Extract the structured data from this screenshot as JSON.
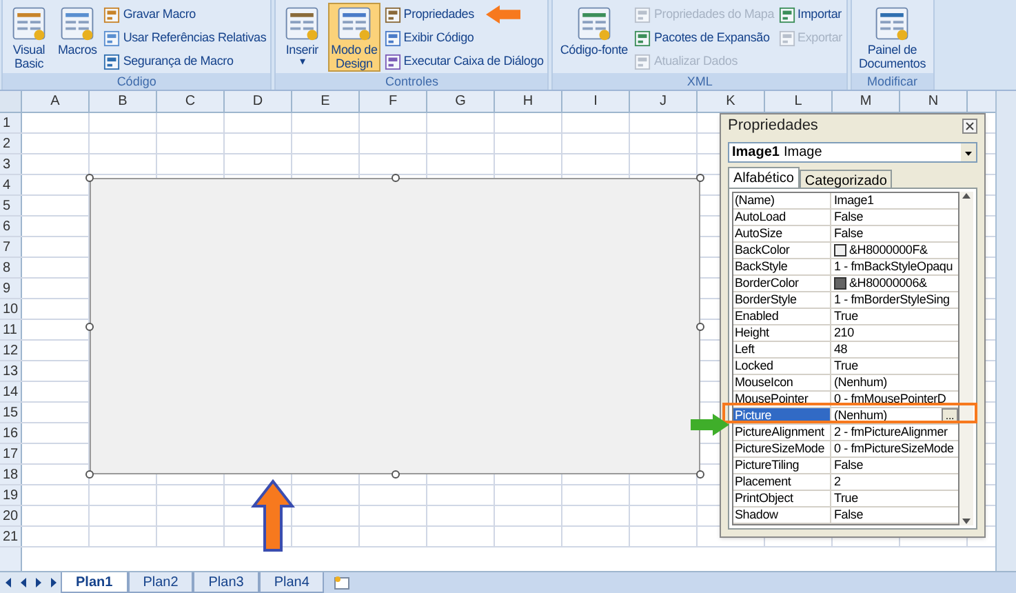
{
  "ribbon": {
    "groups": [
      {
        "label": "Código",
        "items": [
          {
            "kind": "large",
            "lines": [
              "Visual",
              "Basic"
            ],
            "selected": false
          },
          {
            "kind": "large",
            "lines": [
              "Macros"
            ],
            "selected": false
          },
          {
            "kind": "stack",
            "entries": [
              {
                "label": "Gravar Macro",
                "disabled": false
              },
              {
                "label": "Usar Referências Relativas",
                "disabled": false
              },
              {
                "label": "Segurança de Macro",
                "disabled": false
              }
            ]
          }
        ]
      },
      {
        "label": "Controles",
        "items": [
          {
            "kind": "dropdown",
            "lines": [
              "Inserir"
            ],
            "caret": "▾",
            "selected": false
          },
          {
            "kind": "large",
            "lines": [
              "Modo de",
              "Design"
            ],
            "selected": true
          },
          {
            "kind": "stack",
            "entries": [
              {
                "label": "Propriedades",
                "disabled": false
              },
              {
                "label": "Exibir Código",
                "disabled": false
              },
              {
                "label": "Executar Caixa de Diálogo",
                "disabled": false
              }
            ]
          }
        ]
      },
      {
        "label": "XML",
        "items": [
          {
            "kind": "large",
            "lines": [
              "Código-fonte"
            ],
            "selected": false
          },
          {
            "kind": "stack",
            "entries": [
              {
                "label": "Propriedades do Mapa",
                "disabled": true
              },
              {
                "label": "Pacotes de Expansão",
                "disabled": false
              },
              {
                "label": "Atualizar Dados",
                "disabled": true
              }
            ]
          },
          {
            "kind": "stack",
            "entries": [
              {
                "label": "Importar",
                "disabled": false
              },
              {
                "label": "Exportar",
                "disabled": true
              }
            ]
          }
        ]
      },
      {
        "label": "Modificar",
        "items": [
          {
            "kind": "large",
            "lines": [
              "Painel de",
              "Documentos"
            ],
            "selected": false
          }
        ]
      }
    ]
  },
  "sheet": {
    "columns": [
      "A",
      "B",
      "C",
      "D",
      "E",
      "F",
      "G",
      "H",
      "I",
      "J",
      "K",
      "L",
      "M",
      "N"
    ],
    "rows": [
      "1",
      "2",
      "3",
      "4",
      "5",
      "6",
      "7",
      "8",
      "9",
      "10",
      "11",
      "12",
      "13",
      "14",
      "15",
      "16",
      "17",
      "18",
      "19",
      "20",
      "21"
    ]
  },
  "properties": {
    "title": "Propriedades",
    "object_name": "Image1",
    "object_type": "Image",
    "tabs": [
      {
        "label": "Alfabético",
        "selected": true
      },
      {
        "label": "Categorizado",
        "selected": false
      }
    ],
    "rows": [
      {
        "name": "(Name)",
        "value": "Image1",
        "selected": false
      },
      {
        "name": "AutoLoad",
        "value": "False",
        "selected": false
      },
      {
        "name": "AutoSize",
        "value": "False",
        "selected": false
      },
      {
        "name": "BackColor",
        "value": "&H8000000F&",
        "color": "#f0f0f0",
        "selected": false
      },
      {
        "name": "BackStyle",
        "value": "1 - fmBackStyleOpaqu",
        "selected": false
      },
      {
        "name": "BorderColor",
        "value": "&H80000006&",
        "color": "#646464",
        "selected": false
      },
      {
        "name": "BorderStyle",
        "value": "1 - fmBorderStyleSing",
        "selected": false
      },
      {
        "name": "Enabled",
        "value": "True",
        "selected": false
      },
      {
        "name": "Height",
        "value": "210",
        "selected": false
      },
      {
        "name": "Left",
        "value": "48",
        "selected": false
      },
      {
        "name": "Locked",
        "value": "True",
        "selected": false
      },
      {
        "name": "MouseIcon",
        "value": "(Nenhum)",
        "selected": false
      },
      {
        "name": "MousePointer",
        "value": "0 - fmMousePointerD",
        "selected": false
      },
      {
        "name": "Picture",
        "value": "(Nenhum)",
        "selected": true,
        "button": "..."
      },
      {
        "name": "PictureAlignment",
        "value": "2 - fmPictureAlignmer",
        "selected": false
      },
      {
        "name": "PictureSizeMode",
        "value": "0 - fmPictureSizeMode",
        "selected": false
      },
      {
        "name": "PictureTiling",
        "value": "False",
        "selected": false
      },
      {
        "name": "Placement",
        "value": "2",
        "selected": false
      },
      {
        "name": "PrintObject",
        "value": "True",
        "selected": false
      },
      {
        "name": "Shadow",
        "value": "False",
        "selected": false
      }
    ]
  },
  "sheet_tabs": [
    {
      "label": "Plan1",
      "selected": true
    },
    {
      "label": "Plan2",
      "selected": false
    },
    {
      "label": "Plan3",
      "selected": false
    },
    {
      "label": "Plan4",
      "selected": false
    }
  ]
}
